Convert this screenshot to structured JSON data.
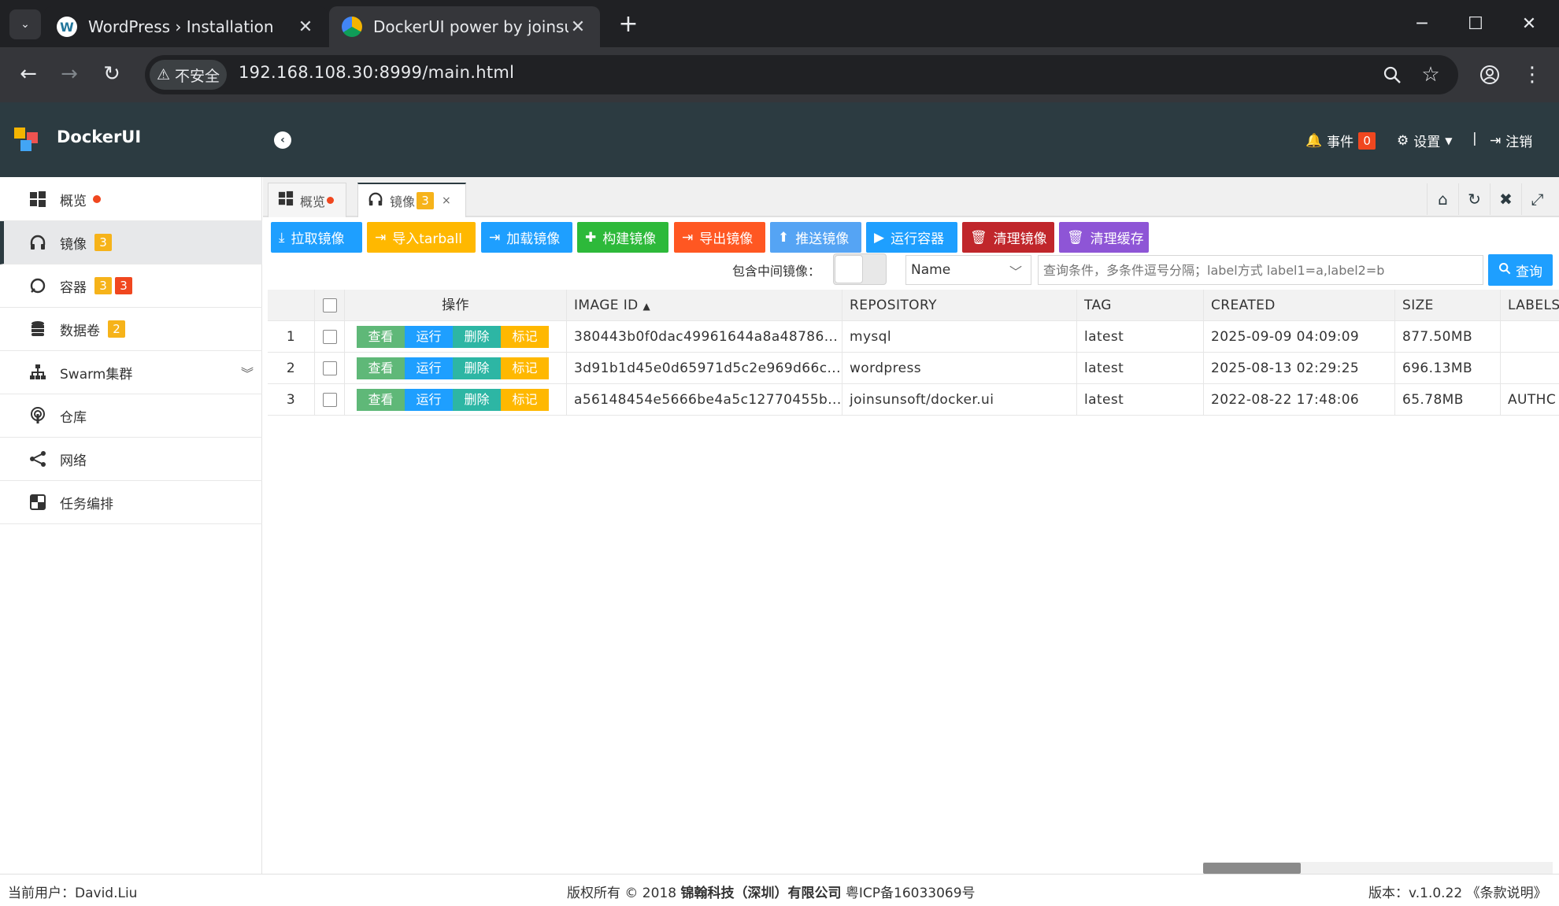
{
  "browser": {
    "tabs": [
      {
        "title": "WordPress › Installation",
        "active": false
      },
      {
        "title": "DockerUI power by joinsunsc",
        "active": true
      }
    ],
    "security_label": "不安全",
    "url": "192.168.108.30:8999/main.html"
  },
  "app": {
    "title": "DockerUI",
    "header": {
      "events_label": "事件",
      "events_count": "0",
      "settings_label": "设置",
      "divider": "|",
      "logout_label": "注销"
    }
  },
  "sidebar": {
    "items": [
      {
        "label": "概览",
        "icon": "windows-icon"
      },
      {
        "label": "镜像",
        "icon": "headphones-icon",
        "badge": "3",
        "active": true
      },
      {
        "label": "容器",
        "icon": "circle-icon",
        "badge1": "3",
        "badge2": "3"
      },
      {
        "label": "数据卷",
        "icon": "database-icon",
        "badge": "2"
      },
      {
        "label": "Swarm集群",
        "icon": "sitemap-icon"
      },
      {
        "label": "仓库",
        "icon": "podcast-icon"
      },
      {
        "label": "网络",
        "icon": "share-icon"
      },
      {
        "label": "任务编排",
        "icon": "puzzle-icon"
      }
    ]
  },
  "content_tabs": [
    {
      "label": "概览"
    },
    {
      "label": "镜像",
      "badge": "3",
      "close": "×"
    }
  ],
  "actions": [
    {
      "label": "拉取镜像",
      "color": "#1e9fff"
    },
    {
      "label": "导入tarball",
      "color": "#ffb800"
    },
    {
      "label": "加载镜像",
      "color": "#1e9fff"
    },
    {
      "label": "构建镜像",
      "color": "#2db93a"
    },
    {
      "label": "导出镜像",
      "color": "#ff5722"
    },
    {
      "label": "推送镜像",
      "color": "#55a4f4"
    },
    {
      "label": "运行容器",
      "color": "#1e9fff"
    },
    {
      "label": "清理镜像",
      "color": "#c0262b"
    },
    {
      "label": "清理缓存",
      "color": "#8e55d6"
    }
  ],
  "filter": {
    "label": "包含中间镜像：",
    "field": "Name",
    "placeholder": "查询条件，多条件逗号分隔；label方式 label1=a,label2=b",
    "search_label": "查询"
  },
  "table": {
    "headers": {
      "ops": "操作",
      "image_id": "IMAGE ID",
      "repository": "REPOSITORY",
      "tag": "TAG",
      "created": "CREATED",
      "size": "SIZE",
      "labels": "LABELS"
    },
    "op_labels": {
      "view": "查看",
      "run": "运行",
      "delete": "删除",
      "tag": "标记"
    },
    "rows": [
      {
        "num": "1",
        "image_id": "380443b0f0dac49961644a8a48786...",
        "repository": "mysql",
        "tag": "latest",
        "created": "2025-09-09 04:09:09",
        "size": "877.50MB",
        "labels": ""
      },
      {
        "num": "2",
        "image_id": "3d91b1d45e0d65971d5c2e969d66c...",
        "repository": "wordpress",
        "tag": "latest",
        "created": "2025-08-13 02:29:25",
        "size": "696.13MB",
        "labels": ""
      },
      {
        "num": "3",
        "image_id": "a56148454e5666be4a5c12770455b...",
        "repository": "joinsunsoft/docker.ui",
        "tag": "latest",
        "created": "2022-08-22 17:48:06",
        "size": "65.78MB",
        "labels": "AUTHC"
      }
    ]
  },
  "footer": {
    "user": "当前用户：David.Liu",
    "copyright_prefix": "版权所有 © 2018 ",
    "company": "锦翰科技（深圳）有限公司",
    "icp": " 粤ICP备16033069号",
    "version": "版本：v.1.0.22 《条款说明》"
  }
}
